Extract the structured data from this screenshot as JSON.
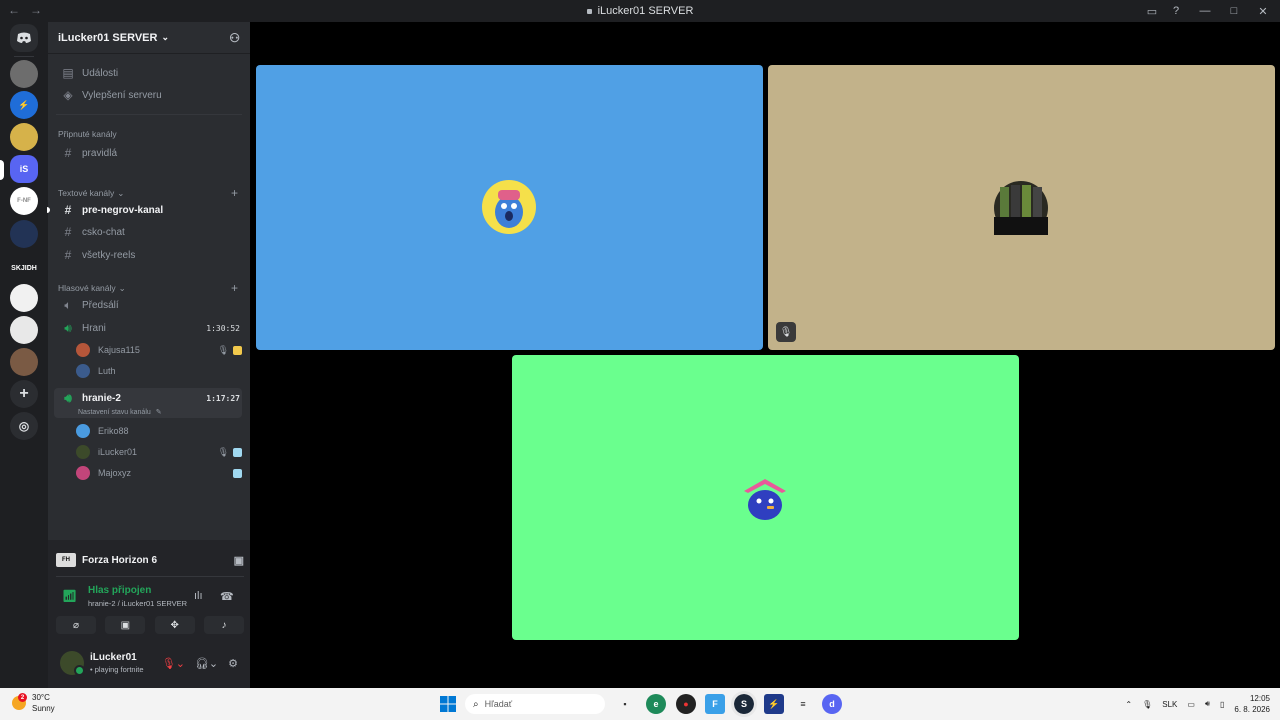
{
  "window": {
    "title": "iLucker01 SERVER",
    "back": "←",
    "forward": "→"
  },
  "server": {
    "name": "iLucker01 SERVER"
  },
  "sidebar": {
    "top_items": [
      {
        "label": "Události",
        "icon": "calendar-icon"
      },
      {
        "label": "Vylepšení serveru",
        "icon": "boost-icon"
      }
    ],
    "pinned_category": "Připnuté kanály",
    "pinned": [
      {
        "label": "pravidlá"
      }
    ],
    "text_category": "Textové kanály",
    "text_channels": [
      {
        "label": "pre-negrov-kanal",
        "unread": true
      },
      {
        "label": "csko-chat"
      },
      {
        "label": "všetky-reels"
      }
    ],
    "voice_category": "Hlasové kanály",
    "voice_channels": [
      {
        "label": "Předsálí"
      },
      {
        "label": "Hrani",
        "timer": "1:30:52",
        "users": [
          {
            "name": "Kajusa115"
          },
          {
            "name": "Luth"
          }
        ]
      },
      {
        "label": "hranie-2",
        "timer": "1:17:27",
        "status": "Nastavení stavu kanálu",
        "users": [
          {
            "name": "Eriko88"
          },
          {
            "name": "iLucker01"
          },
          {
            "name": "Majoxyz"
          }
        ]
      }
    ]
  },
  "bottom": {
    "game": "Forza Horizon 6",
    "voice_status": "Hlas připojen",
    "voice_sub": "hranie-2 / iLucker01 SERVER",
    "user": {
      "name": "iLucker01",
      "status": "• playing fortnite"
    }
  },
  "stage": {
    "tiles": [
      {
        "name": "tile-1",
        "color": "#50a0e5"
      },
      {
        "name": "tile-2",
        "color": "#c2b28a",
        "muted": true
      },
      {
        "name": "tile-3",
        "color": "#6aff8e"
      }
    ]
  },
  "taskbar": {
    "weather_temp": "30°C",
    "weather_desc": "Sunny",
    "weather_badge": "2",
    "search_placeholder": "Hľadať",
    "lang": "SLK",
    "time": "12:05",
    "date": "6. 8. 2026"
  }
}
